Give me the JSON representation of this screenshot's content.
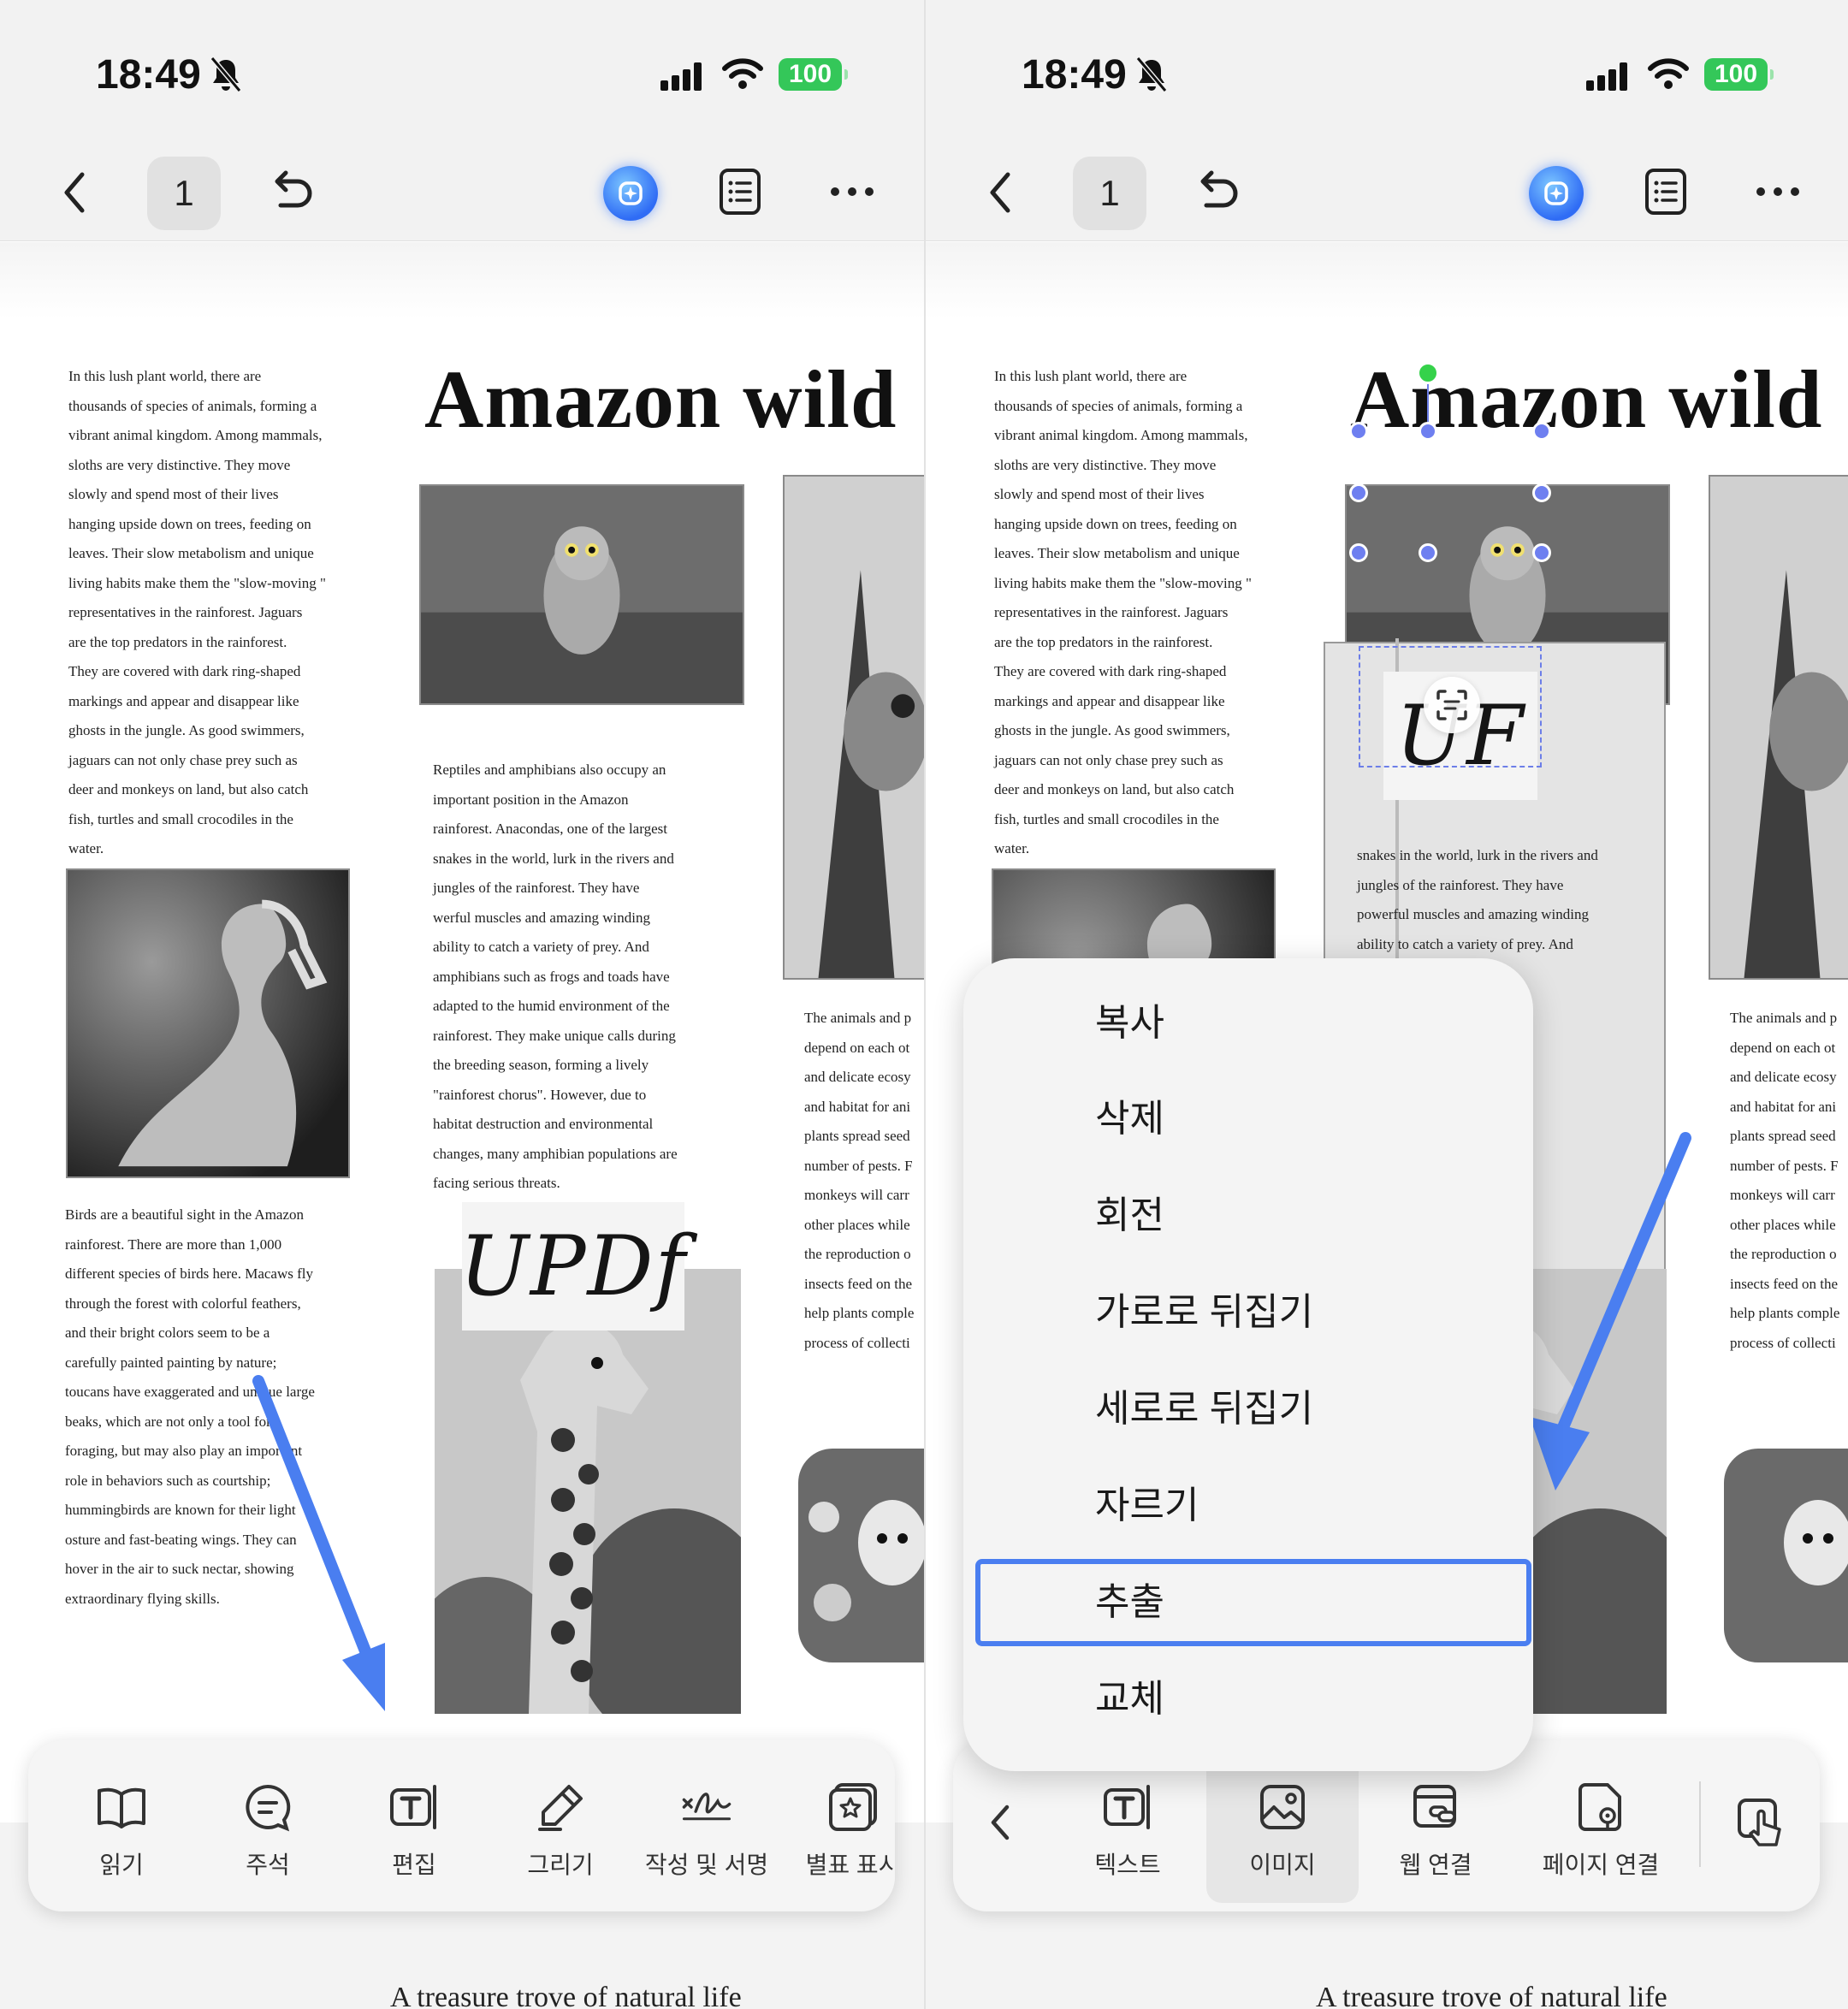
{
  "status_bar": {
    "time": "18:49",
    "battery": "100"
  },
  "toolbar": {
    "page_number": "1"
  },
  "document": {
    "title": "Amazon wild",
    "column1_paragraph1": "In this lush plant world, there are\nthousands of species of animals, forming a\nvibrant animal kingdom. Among mammals,\nsloths are very distinctive. They move\nslowly and spend most of their lives\nhanging upside down on trees, feeding on\nleaves. Their slow metabolism and unique\nliving habits make them the \"slow-moving \"\nrepresentatives in the rainforest. Jaguars\nare the top predators in the rainforest.\nThey are covered with dark ring-shaped\nmarkings and appear and disappear like\nghosts in the jungle. As good swimmers,\njaguars can not only chase prey such as\ndeer and monkeys on land, but also catch\nfish, turtles and small crocodiles in the\nwater.",
    "column1_paragraph2": "Birds are a beautiful sight in the Amazon\nrainforest. There are more than 1,000\ndifferent species of birds here. Macaws fly\nthrough the forest with colorful feathers,\nand their bright colors seem to be a\ncarefully painted painting by nature;\ntoucans have exaggerated and unique large\nbeaks, which are not  only a tool for\nforaging, but may also play an important\nrole in behaviors such as courtship;\nhummingbirds are known for their light\n  osture and fast-beating wings. They can\nhover in the air to suck nectar, showing\nextraordinary flying skills.",
    "column2_paragraph": "Reptiles and amphibians also occupy an\nimportant position in the Amazon\nrainforest. Anacondas, one of the largest\nsnakes in the world, lurk in the rivers and\njungles of the rainforest. They have\n    werful muscles and amazing winding\nability to catch a variety of prey. And\namphibians such as frogs and toads have\nadapted to the humid environment of the\nrainforest. They make unique calls during\nthe breeding season, forming a lively\n\"rainforest chorus\". However, due to\nhabitat destruction and environmental\nchanges, many amphibian populations are\nfacing serious threats.",
    "column2_paragraph_right": "snakes in the world, lurk in the rivers and\njungles of the rainforest. They have\npowerful muscles and amazing winding\nability to catch a variety of prey. And\n                      s and toads have\n                    onment of the\n                    ue calls during\n                    g a lively\n                    er, due to\n                    ronmental\n                    opulations are",
    "column3_paragraph": "The animals and p\ndepend on each ot\nand delicate ecosy\nand habitat for ani\nplants spread seed\nnumber of pests. F\nmonkeys will carr\nother places while\nthe reproduction o\ninsects feed on the\nhelp plants comple\nprocess of collecti",
    "signature": "UPDf",
    "signature_clipped": "UF",
    "bottom_title": "A treasure trove of natural life"
  },
  "left_dock": {
    "items": [
      {
        "label": "읽기",
        "icon": "book-icon"
      },
      {
        "label": "주석",
        "icon": "comment-icon"
      },
      {
        "label": "편집",
        "icon": "edit-text-icon"
      },
      {
        "label": "그리기",
        "icon": "pencil-icon"
      },
      {
        "label": "작성 및 서명",
        "icon": "signature-icon"
      },
      {
        "label": "별표 표시",
        "icon": "star-stamp-icon"
      }
    ]
  },
  "right_dock": {
    "items": [
      {
        "label": "텍스트",
        "icon": "text-box-icon"
      },
      {
        "label": "이미지",
        "icon": "image-icon",
        "selected": true
      },
      {
        "label": "웹 연결",
        "icon": "web-link-icon"
      },
      {
        "label": "페이지 연결",
        "icon": "page-link-icon"
      }
    ]
  },
  "context_menu": {
    "items": [
      "복사",
      "삭제",
      "회전",
      "가로로 뒤집기",
      "세로로 뒤집기",
      "자르기",
      "추출",
      "교체"
    ],
    "highlighted": "추출"
  },
  "colors": {
    "accent": "#4a7ef0",
    "arrow": "#4a7ef0",
    "battery": "#34c759",
    "handle": "#6e7ff0",
    "rotate_handle": "#35d24a"
  }
}
